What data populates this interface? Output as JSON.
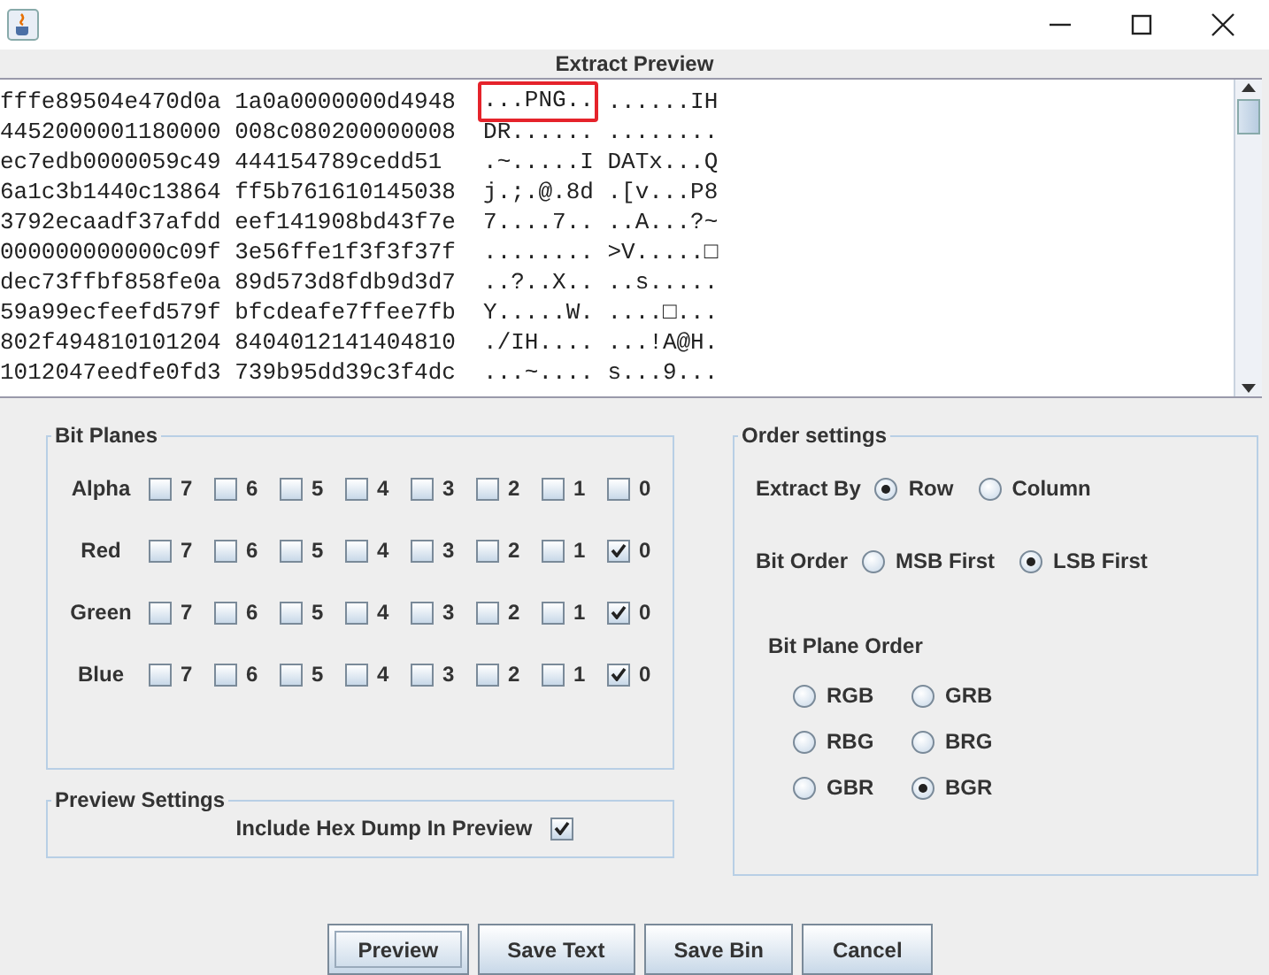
{
  "preview": {
    "title": "Extract Preview",
    "lines": [
      {
        "hex": [
          "fffe89504e470d0a",
          "1a0a0000000d4948"
        ],
        "ascii": [
          "...PNG..",
          "......IH"
        ],
        "highlighted": true
      },
      {
        "hex": [
          "4452000001180000",
          "008c080200000008"
        ],
        "ascii": [
          "DR......",
          "........"
        ],
        "highlighted": false
      },
      {
        "hex": [
          "ec7edb0000059c49",
          "444154789cedd51"
        ],
        "ascii": [
          ".~.....I",
          "DATx...Q"
        ],
        "highlighted": false
      },
      {
        "hex": [
          "6a1c3b1440c13864",
          "ff5b761610145038"
        ],
        "ascii": [
          "j.;.@.8d",
          ".[v...P8"
        ],
        "highlighted": false
      },
      {
        "hex": [
          "3792ecaadf37afdd",
          "eef141908bd43f7e"
        ],
        "ascii": [
          "7....7..",
          "..A...?~"
        ],
        "highlighted": false
      },
      {
        "hex": [
          "000000000000c09f",
          "3e56ffe1f3f3f37f"
        ],
        "ascii": [
          "........",
          ">V.....□"
        ],
        "highlighted": false
      },
      {
        "hex": [
          "dec73ffbf858fe0a",
          "89d573d8fdb9d3d7"
        ],
        "ascii": [
          "..?..X..",
          "..s....."
        ],
        "highlighted": false
      },
      {
        "hex": [
          "59a99ecfeefd579f",
          "bfcdeafe7ffee7fb"
        ],
        "ascii": [
          "Y.....W.",
          "....□..."
        ],
        "highlighted": false
      },
      {
        "hex": [
          "802f494810101204",
          "8404012141404810"
        ],
        "ascii": [
          "./IH....",
          "...!A@H."
        ],
        "highlighted": false
      },
      {
        "hex": [
          "1012047eedfe0fd3",
          "739b95dd39c3f4dc"
        ],
        "ascii": [
          "...~....",
          "s...9..."
        ],
        "highlighted": false
      }
    ]
  },
  "bit_planes": {
    "title": "Bit Planes",
    "channels": [
      {
        "name": "Alpha",
        "bits": [
          {
            "label": "7",
            "checked": false
          },
          {
            "label": "6",
            "checked": false
          },
          {
            "label": "5",
            "checked": false
          },
          {
            "label": "4",
            "checked": false
          },
          {
            "label": "3",
            "checked": false
          },
          {
            "label": "2",
            "checked": false
          },
          {
            "label": "1",
            "checked": false
          },
          {
            "label": "0",
            "checked": false
          }
        ]
      },
      {
        "name": "Red",
        "bits": [
          {
            "label": "7",
            "checked": false
          },
          {
            "label": "6",
            "checked": false
          },
          {
            "label": "5",
            "checked": false
          },
          {
            "label": "4",
            "checked": false
          },
          {
            "label": "3",
            "checked": false
          },
          {
            "label": "2",
            "checked": false
          },
          {
            "label": "1",
            "checked": false
          },
          {
            "label": "0",
            "checked": true
          }
        ]
      },
      {
        "name": "Green",
        "bits": [
          {
            "label": "7",
            "checked": false
          },
          {
            "label": "6",
            "checked": false
          },
          {
            "label": "5",
            "checked": false
          },
          {
            "label": "4",
            "checked": false
          },
          {
            "label": "3",
            "checked": false
          },
          {
            "label": "2",
            "checked": false
          },
          {
            "label": "1",
            "checked": false
          },
          {
            "label": "0",
            "checked": true
          }
        ]
      },
      {
        "name": "Blue",
        "bits": [
          {
            "label": "7",
            "checked": false
          },
          {
            "label": "6",
            "checked": false
          },
          {
            "label": "5",
            "checked": false
          },
          {
            "label": "4",
            "checked": false
          },
          {
            "label": "3",
            "checked": false
          },
          {
            "label": "2",
            "checked": false
          },
          {
            "label": "1",
            "checked": false
          },
          {
            "label": "0",
            "checked": true
          }
        ]
      }
    ]
  },
  "preview_settings": {
    "title": "Preview Settings",
    "include_hex_dump": {
      "label": "Include Hex Dump In Preview",
      "checked": true
    }
  },
  "order_settings": {
    "title": "Order settings",
    "extract_by": {
      "label": "Extract By",
      "options": [
        {
          "label": "Row",
          "selected": true
        },
        {
          "label": "Column",
          "selected": false
        }
      ]
    },
    "bit_order": {
      "label": "Bit Order",
      "options": [
        {
          "label": "MSB First",
          "selected": false
        },
        {
          "label": "LSB First",
          "selected": true
        }
      ]
    },
    "bit_plane_order": {
      "label": "Bit Plane Order",
      "options": [
        {
          "label": "RGB",
          "selected": false
        },
        {
          "label": "GRB",
          "selected": false
        },
        {
          "label": "RBG",
          "selected": false
        },
        {
          "label": "BRG",
          "selected": false
        },
        {
          "label": "GBR",
          "selected": false
        },
        {
          "label": "BGR",
          "selected": true
        }
      ]
    }
  },
  "buttons": [
    {
      "label": "Preview",
      "focused": true
    },
    {
      "label": "Save Text",
      "focused": false
    },
    {
      "label": "Save Bin",
      "focused": false
    },
    {
      "label": "Cancel",
      "focused": false
    }
  ]
}
